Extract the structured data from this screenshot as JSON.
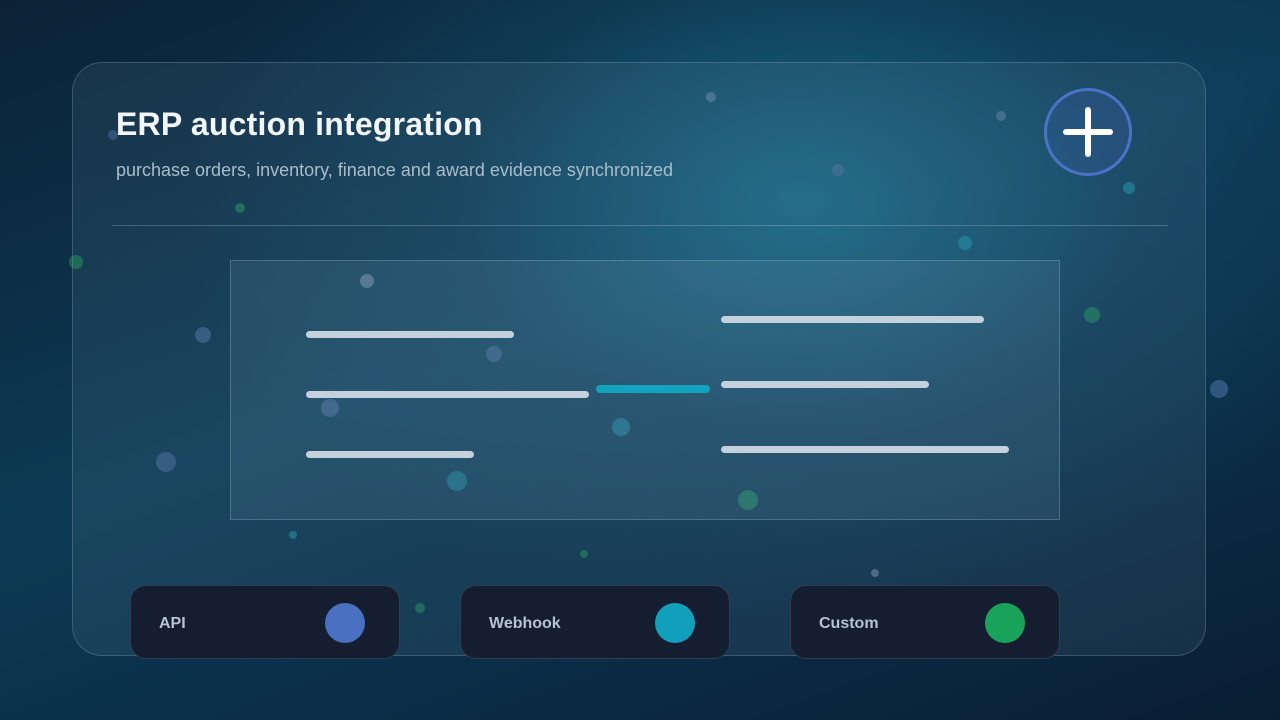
{
  "header": {
    "title": "ERP auction integration",
    "subtitle": "purchase orders, inventory, finance and award evidence synchronized"
  },
  "actions": {
    "add_icon": "plus-icon"
  },
  "integrations": [
    {
      "label": "API",
      "color": "#4a70c2"
    },
    {
      "label": "Webhook",
      "color": "#10a0bb"
    },
    {
      "label": "Custom",
      "color": "#19a25a"
    }
  ],
  "colors": {
    "accent_blue": "#4a73c8",
    "accent_teal": "#14a3bd",
    "accent_green": "#19a25a",
    "panel_dark": "#141e30"
  }
}
